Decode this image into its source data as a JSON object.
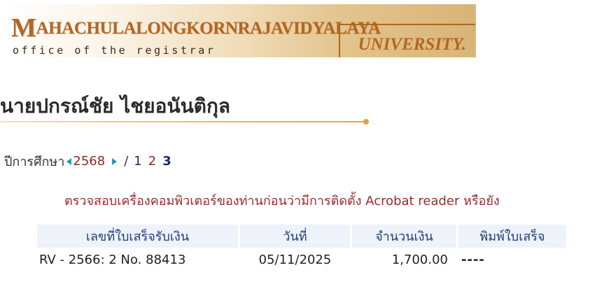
{
  "banner": {
    "title_initial": "M",
    "title_rest": "AHACHULALONGKORNRAJAVIDYALAYA",
    "subtitle": "office of the registrar",
    "university": "UNIVERSITY."
  },
  "student": {
    "name": "นายปกรณ์ชัย ไชยอนันติกุล"
  },
  "year_selector": {
    "label": "ปีการศึกษา",
    "year": "2568",
    "separator": "/",
    "semesters": [
      "1",
      "2",
      "3"
    ]
  },
  "notice": "ตรวจสอบเครื่องคอมพิวเตอร์ของท่านก่อนว่ามีการติดตั้ง Acrobat reader หรือยัง",
  "receipts_table": {
    "headers": [
      "เลขที่ใบเสร็จรับเงิน",
      "วันที่",
      "จำนวนเงิน",
      "พิมพ์ใบเสร็จ"
    ],
    "rows": [
      {
        "receipt_no": "RV - 2566: 2 No. 88413",
        "date": "05/11/2025",
        "amount": "1,700.00",
        "print": "----"
      }
    ]
  },
  "colors": {
    "banner_text": "#b5651f",
    "name_rule": "#e8a23c",
    "arrow": "#1a9fb5",
    "notice": "#9b2b2b",
    "table_header_bg": "#eef2fb",
    "table_header_text": "#1f3e7a"
  },
  "icons": [
    "arrow-left-icon",
    "arrow-right-icon"
  ]
}
